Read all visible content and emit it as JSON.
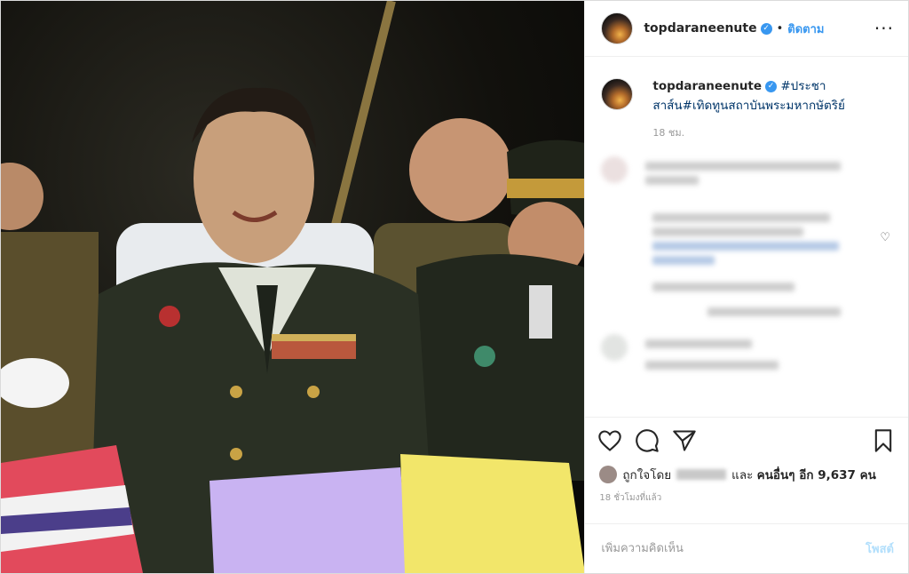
{
  "post": {
    "username": "topdaraneenute",
    "follow_label": "ติดตาม",
    "more_label": "···"
  },
  "caption": {
    "username": "topdaraneenute",
    "text": "#ประชาสาส์น#เทิดทูนสถาบันพระมหากษัตริย์",
    "time": "18 ชม."
  },
  "likes": {
    "prefix": "ถูกใจโดย",
    "middle": "และ",
    "others": "คนอื่นๆ อีก 9,637 คน"
  },
  "time_ago": "18 ชั่วโมงที่แล้ว",
  "comment_box": {
    "placeholder": "เพิ่มความคิดเห็น",
    "post_label": "โพสต์"
  },
  "icons": {
    "like": "heart-icon",
    "comment": "comment-icon",
    "share": "share-icon",
    "save": "bookmark-icon",
    "verified": "verified-badge-icon",
    "comment_like": "heart-outline-icon"
  },
  "colors": {
    "accent": "#3897f0",
    "post_disabled": "#b2dffc",
    "hashtag": "#003569"
  }
}
